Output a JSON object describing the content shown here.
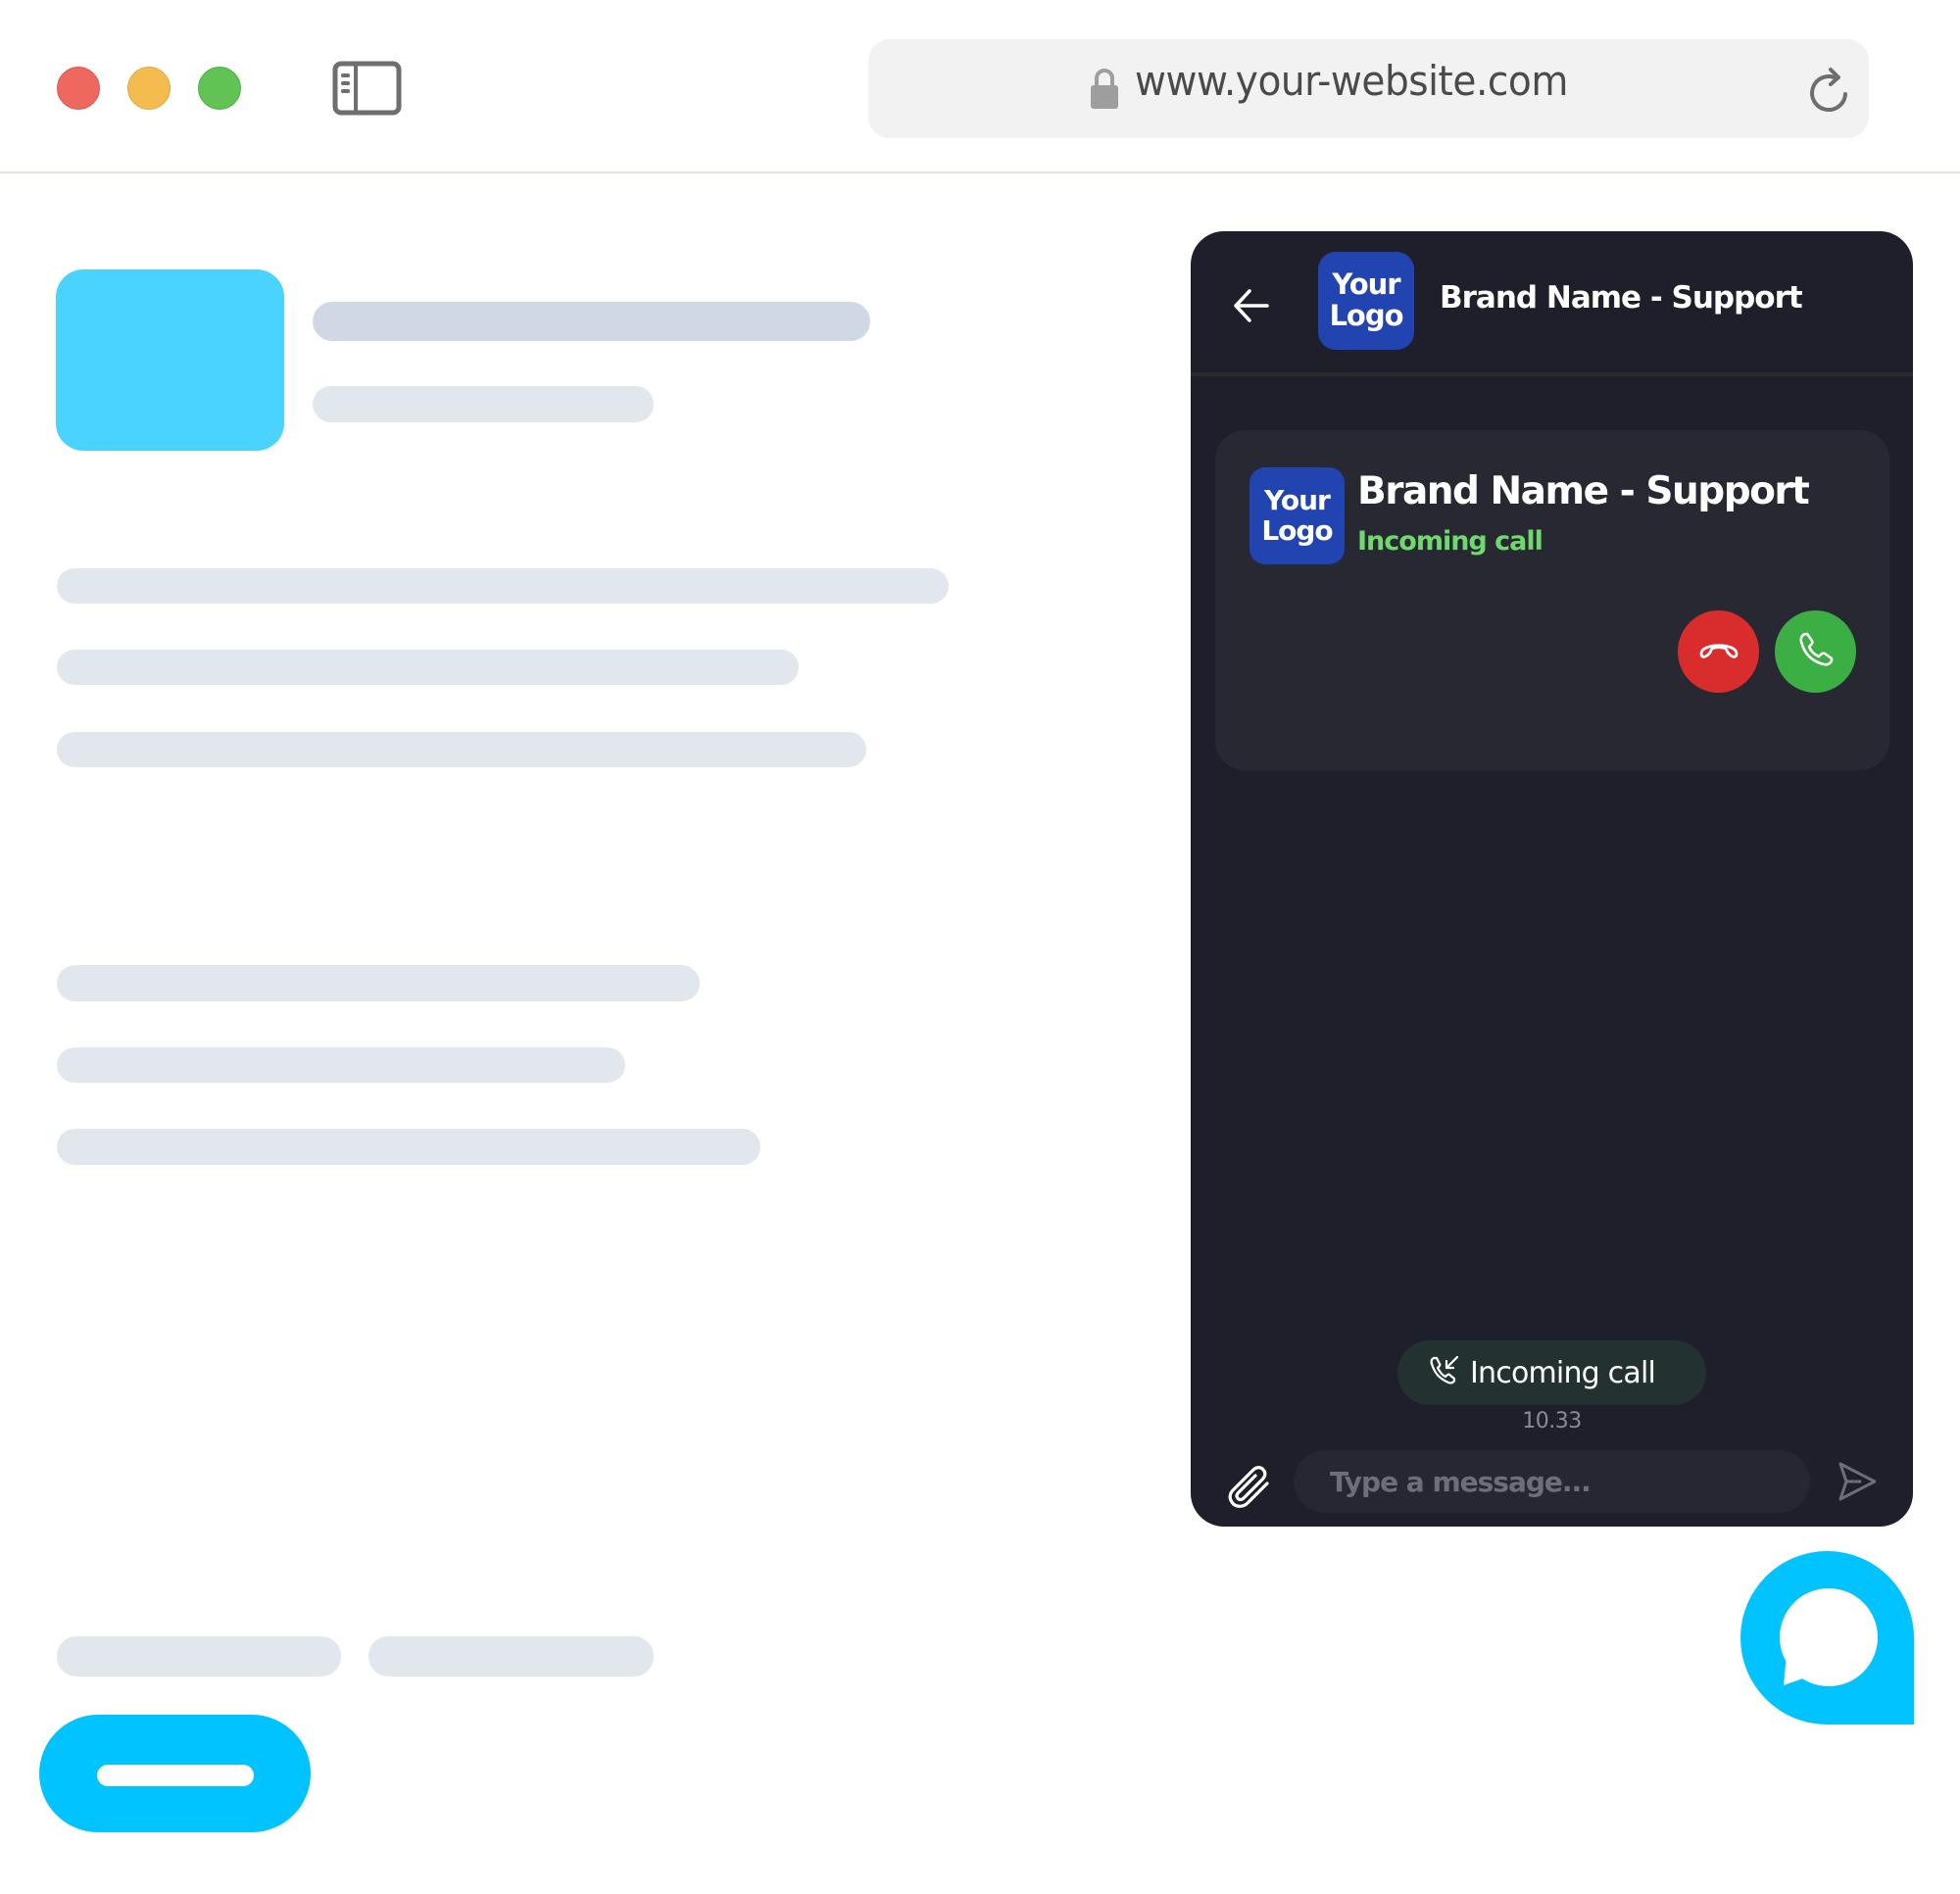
{
  "browser": {
    "traffic_lights": [
      "close",
      "minimize",
      "maximize"
    ],
    "url": "www.your-website.com",
    "icons": {
      "sidebar": "sidebar-toggle-icon",
      "lock": "lock-icon",
      "reload": "reload-icon"
    }
  },
  "page": {
    "hero_color": "#4bd3ff",
    "cta_color": "#00c3ff"
  },
  "chat": {
    "header": {
      "back_icon": "arrow-left-icon",
      "logo_line1": "Your",
      "logo_line2": "Logo",
      "title": "Brand Name - Support"
    },
    "call_card": {
      "logo_line1": "Your",
      "logo_line2": "Logo",
      "title": "Brand Name  - Support",
      "status": "Incoming call",
      "status_color": "#6fd96d",
      "decline_icon": "phone-hangup-icon",
      "accept_icon": "phone-icon"
    },
    "event": {
      "icon": "incoming-call-icon",
      "label": "Incoming call",
      "time": "10.33"
    },
    "composer": {
      "attach_icon": "paperclip-icon",
      "placeholder": "Type a message...",
      "value": "",
      "send_icon": "send-icon"
    },
    "colors": {
      "panel_bg": "#1f1f2b",
      "card_bg": "#282833",
      "logo_bg": "#2144b0",
      "decline": "#d92c2c",
      "accept": "#3bae44"
    }
  },
  "launcher": {
    "icon": "chat-bubble-icon",
    "color": "#00c3ff"
  }
}
